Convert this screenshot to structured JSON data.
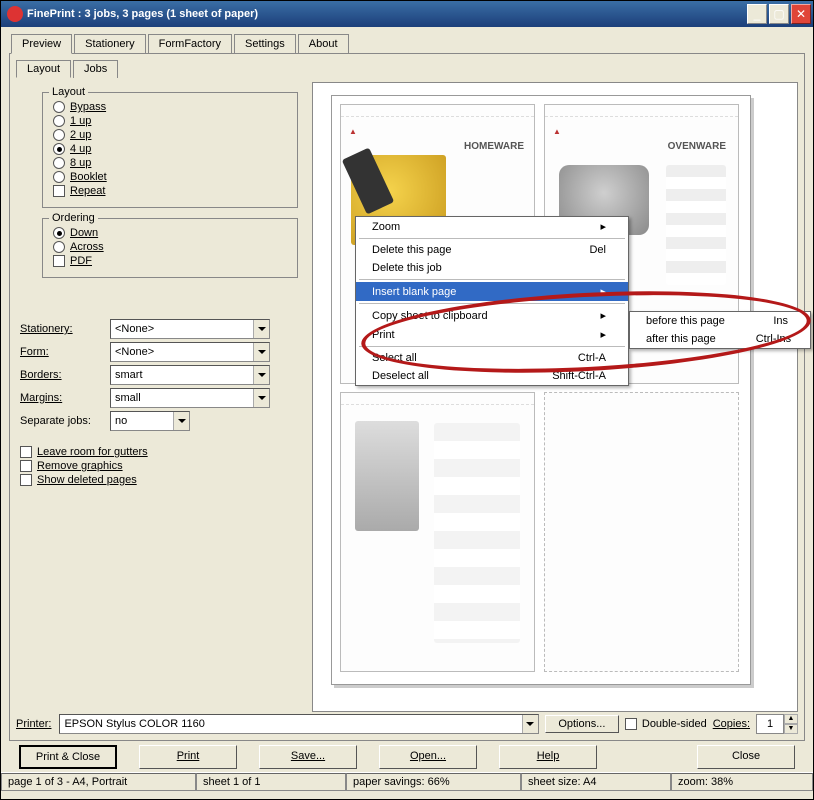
{
  "window": {
    "title": "FinePrint : 3 jobs, 3 pages (1 sheet of paper)"
  },
  "tabs": {
    "t0": "Preview",
    "t1": "Stationery",
    "t2": "FormFactory",
    "t3": "Settings",
    "t4": "About"
  },
  "subtabs": {
    "s0": "Layout",
    "s1": "Jobs"
  },
  "layout_group": {
    "legend": "Layout",
    "bypass": "Bypass",
    "up1": "1 up",
    "up2": "2 up",
    "up4": "4 up",
    "up8": "8 up",
    "booklet": "Booklet",
    "repeat": "Repeat"
  },
  "ordering_group": {
    "legend": "Ordering",
    "down": "Down",
    "across": "Across",
    "pdf": "PDF"
  },
  "form": {
    "stationery_label": "Stationery:",
    "stationery_val": "<None>",
    "form_label": "Form:",
    "form_val": "<None>",
    "borders_label": "Borders:",
    "borders_val": "smart",
    "margins_label": "Margins:",
    "margins_val": "small",
    "sepjobs_label": "Separate jobs:",
    "sepjobs_val": "no"
  },
  "checks": {
    "gutters": "Leave room for gutters",
    "removegfx": "Remove graphics",
    "showdel": "Show deleted pages"
  },
  "printerrow": {
    "label": "Printer:",
    "value": "EPSON Stylus COLOR 1160",
    "options": "Options...",
    "doublesided": "Double-sided",
    "copies_label": "Copies:",
    "copies_val": "1"
  },
  "actions": {
    "printclose": "Print & Close",
    "print": "Print",
    "save": "Save...",
    "open": "Open...",
    "help": "Help",
    "close": "Close"
  },
  "context": {
    "zoom": "Zoom",
    "delpage": "Delete this page",
    "delpage_sc": "Del",
    "deljob": "Delete this job",
    "insblank": "Insert blank page",
    "copysheet": "Copy sheet to clipboard",
    "print": "Print",
    "selectall": "Select all",
    "selectall_sc": "Ctrl-A",
    "deselectall": "Deselect all",
    "deselectall_sc": "Shift-Ctrl-A"
  },
  "submenu": {
    "before": "before this page",
    "before_sc": "Ins",
    "after": "after this page",
    "after_sc": "Ctrl-Ins"
  },
  "status": {
    "page": "page 1 of 3 - A4, Portrait",
    "sheet": "sheet 1 of 1",
    "savings": "paper savings: 66%",
    "size": "sheet size: A4",
    "zoom": "zoom: 38%"
  },
  "thumbs": {
    "t1": "HOMEWARE",
    "t2": "OVENWARE"
  }
}
